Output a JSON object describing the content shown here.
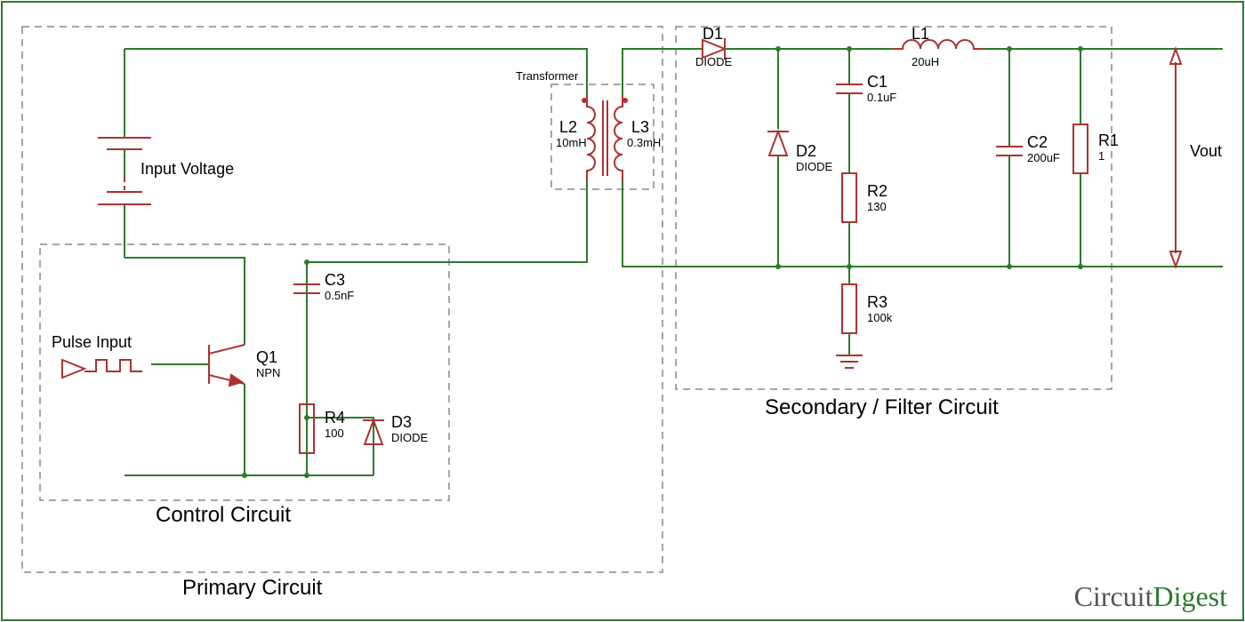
{
  "circuit": {
    "input_voltage_label": "Input Voltage",
    "pulse_input_label": "Pulse Input",
    "vout_label": "Vout",
    "transformer_label": "Transformer",
    "sections": {
      "primary": "Primary Circuit",
      "control": "Control Circuit",
      "secondary": "Secondary / Filter Circuit"
    },
    "components": {
      "Q1": {
        "ref": "Q1",
        "value": "NPN"
      },
      "C3": {
        "ref": "C3",
        "value": "0.5nF"
      },
      "R4": {
        "ref": "R4",
        "value": "100"
      },
      "D3": {
        "ref": "D3",
        "value": "DIODE"
      },
      "L2": {
        "ref": "L2",
        "value": "10mH"
      },
      "L3": {
        "ref": "L3",
        "value": "0.3mH"
      },
      "D1": {
        "ref": "D1",
        "value": "DIODE"
      },
      "D2": {
        "ref": "D2",
        "value": "DIODE"
      },
      "C1": {
        "ref": "C1",
        "value": "0.1uF"
      },
      "R2": {
        "ref": "R2",
        "value": "130"
      },
      "R3": {
        "ref": "R3",
        "value": "100k"
      },
      "L1": {
        "ref": "L1",
        "value": "20uH"
      },
      "C2": {
        "ref": "C2",
        "value": "200uF"
      },
      "R1": {
        "ref": "R1",
        "value": "1"
      }
    },
    "logo": {
      "a": "Circu",
      "b": "i",
      "c": "t",
      "d": "Digest"
    }
  }
}
